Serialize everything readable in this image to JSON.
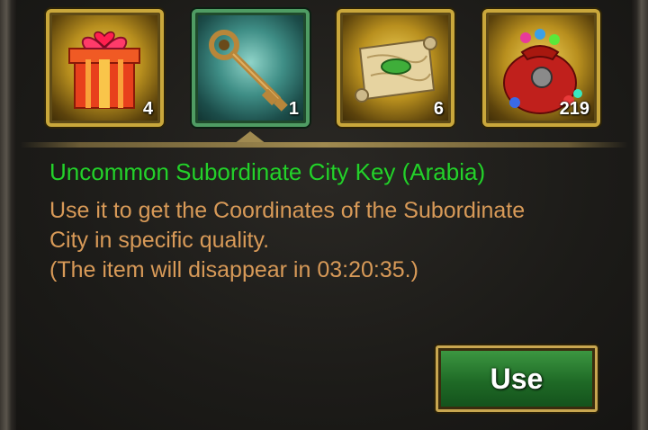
{
  "items": [
    {
      "icon": "gift-box-icon",
      "count": "4"
    },
    {
      "icon": "key-icon",
      "count": "1"
    },
    {
      "icon": "map-scroll-icon",
      "count": "6"
    },
    {
      "icon": "treasure-sack-icon",
      "count": "219"
    }
  ],
  "selected_index": 1,
  "detail": {
    "title": "Uncommon Subordinate City Key (Arabia)",
    "line1": "Use it to get the Coordinates of the Subordinate",
    "line2": "City in specific quality.",
    "line3": "(The item will disappear in 03:20:35.)"
  },
  "use_button": {
    "label": "Use"
  },
  "colors": {
    "title": "#25d02b",
    "description": "#d89a58",
    "button": "#1f6a26",
    "slot_border": "#c9a73b"
  }
}
